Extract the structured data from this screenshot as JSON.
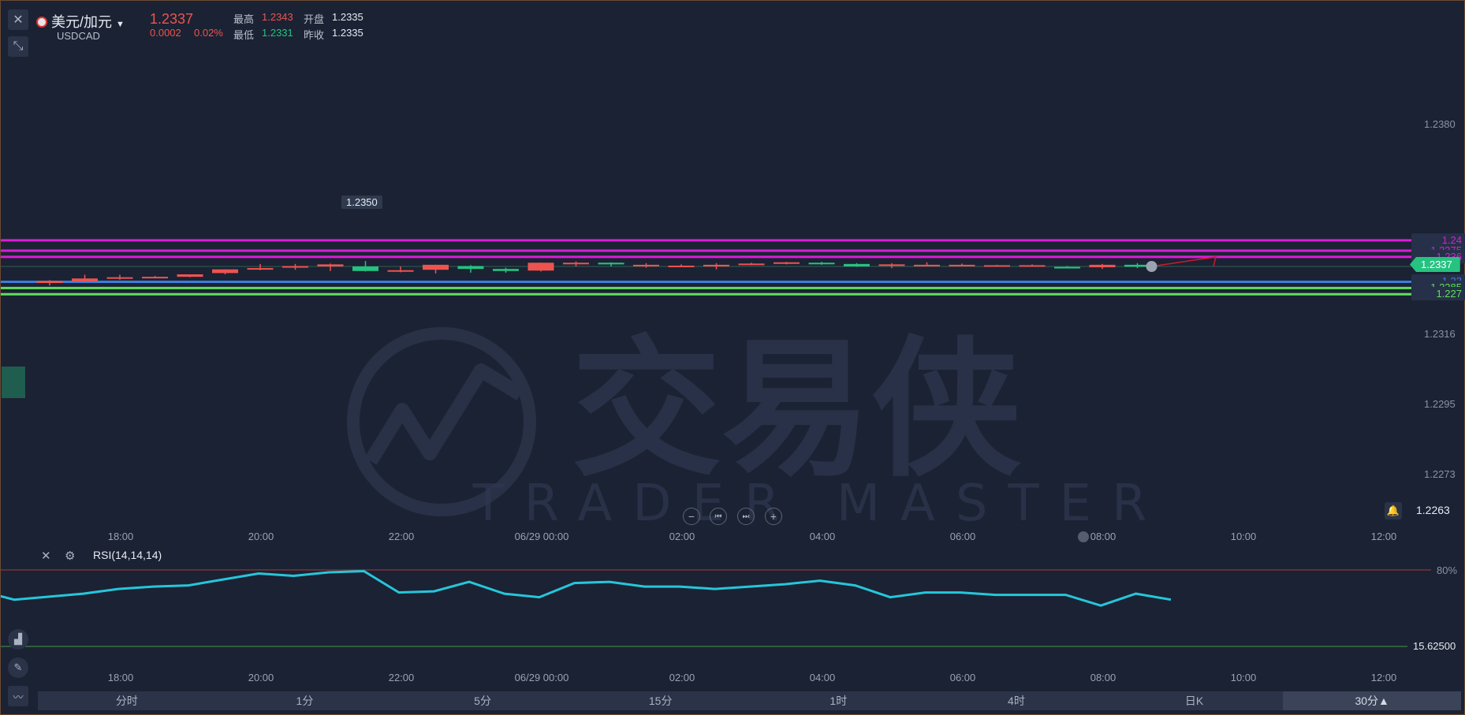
{
  "header": {
    "pair_name": "美元/加元",
    "symbol": "USDCAD",
    "last_price": "1.2337",
    "change": "0.0002",
    "change_pct": "0.02%",
    "high_label": "最高",
    "high_value": "1.2343",
    "open_label": "开盘",
    "open_value": "1.2335",
    "low_label": "最低",
    "low_value": "1.2331",
    "prev_close_label": "昨收",
    "prev_close_value": "1.2335"
  },
  "price_axis": [
    "1.2380",
    "1.2316",
    "1.2295",
    "1.2273",
    "1.2263"
  ],
  "level_lines": [
    {
      "label": "1.24",
      "price": 1.24,
      "color": "#d81ed6"
    },
    {
      "label": "1.2375",
      "price": 1.2375,
      "color": "#d81ed6"
    },
    {
      "label": "1.236",
      "price": 1.236,
      "color": "#d81ed6"
    },
    {
      "label": "1.23",
      "price": 1.23,
      "color": "#3b7ddd"
    },
    {
      "label": "1.2285",
      "price": 1.2285,
      "color": "#5ee05a"
    },
    {
      "label": "1.227",
      "price": 1.227,
      "color": "#5ee05a"
    }
  ],
  "current_price_tag": "1.2337",
  "max_annotation": "1.2350",
  "alert_price": "1.2263",
  "watermark": {
    "cn": "交易侠",
    "en": "TRADER MASTER"
  },
  "time_axis": [
    "18:00",
    "20:00",
    "22:00",
    "06/29 00:00",
    "02:00",
    "04:00",
    "06:00",
    "08:00",
    "10:00",
    "12:00"
  ],
  "rsi": {
    "label": "RSI(14,14,14)",
    "upper_level": "80%",
    "lower_value": "15.62500"
  },
  "tabs": [
    "分时",
    "1分",
    "5分",
    "15分",
    "1时",
    "4时",
    "日K",
    "30分▲"
  ],
  "colors": {
    "bull": "#ef5350",
    "bear": "#26c281",
    "rsi": "#26c6da",
    "background": "#1b2233"
  },
  "chart_data": {
    "type": "candlestick",
    "title": "",
    "candles": [
      {
        "o": 1.2297,
        "h": 1.2304,
        "l": 1.2291,
        "c": 1.2302
      },
      {
        "o": 1.2301,
        "h": 1.2317,
        "l": 1.2299,
        "c": 1.2308
      },
      {
        "o": 1.2308,
        "h": 1.2317,
        "l": 1.2305,
        "c": 1.2311
      },
      {
        "o": 1.2312,
        "h": 1.2314,
        "l": 1.231,
        "c": 1.2312
      },
      {
        "o": 1.2312,
        "h": 1.2318,
        "l": 1.2311,
        "c": 1.2318
      },
      {
        "o": 1.2321,
        "h": 1.233,
        "l": 1.2318,
        "c": 1.233
      },
      {
        "o": 1.233,
        "h": 1.2343,
        "l": 1.2328,
        "c": 1.2333
      },
      {
        "o": 1.2334,
        "h": 1.2343,
        "l": 1.2329,
        "c": 1.2338
      },
      {
        "o": 1.2337,
        "h": 1.2344,
        "l": 1.2326,
        "c": 1.2342
      },
      {
        "o": 1.2337,
        "h": 1.235,
        "l": 1.2325,
        "c": 1.2326
      },
      {
        "o": 1.2328,
        "h": 1.2337,
        "l": 1.2323,
        "c": 1.2328
      },
      {
        "o": 1.2329,
        "h": 1.2341,
        "l": 1.232,
        "c": 1.2341
      },
      {
        "o": 1.2338,
        "h": 1.234,
        "l": 1.2322,
        "c": 1.2331
      },
      {
        "o": 1.2331,
        "h": 1.2334,
        "l": 1.2322,
        "c": 1.2326
      },
      {
        "o": 1.2327,
        "h": 1.2346,
        "l": 1.2325,
        "c": 1.2346
      },
      {
        "o": 1.2345,
        "h": 1.2349,
        "l": 1.2337,
        "c": 1.2346
      },
      {
        "o": 1.2346,
        "h": 1.2347,
        "l": 1.2337,
        "c": 1.2342
      },
      {
        "o": 1.2341,
        "h": 1.2345,
        "l": 1.2334,
        "c": 1.2341
      },
      {
        "o": 1.2338,
        "h": 1.2342,
        "l": 1.2336,
        "c": 1.2339
      },
      {
        "o": 1.2337,
        "h": 1.2345,
        "l": 1.233,
        "c": 1.2341
      },
      {
        "o": 1.2342,
        "h": 1.2346,
        "l": 1.234,
        "c": 1.2344
      },
      {
        "o": 1.2346,
        "h": 1.2348,
        "l": 1.2342,
        "c": 1.2347
      },
      {
        "o": 1.2346,
        "h": 1.2348,
        "l": 1.2341,
        "c": 1.2345
      },
      {
        "o": 1.2343,
        "h": 1.2345,
        "l": 1.2336,
        "c": 1.2337
      },
      {
        "o": 1.234,
        "h": 1.2345,
        "l": 1.2333,
        "c": 1.2342
      },
      {
        "o": 1.2341,
        "h": 1.2347,
        "l": 1.2339,
        "c": 1.2341
      },
      {
        "o": 1.2341,
        "h": 1.2344,
        "l": 1.2339,
        "c": 1.2341
      },
      {
        "o": 1.234,
        "h": 1.2341,
        "l": 1.2337,
        "c": 1.234
      },
      {
        "o": 1.234,
        "h": 1.2342,
        "l": 1.2336,
        "c": 1.234
      },
      {
        "o": 1.2336,
        "h": 1.2338,
        "l": 1.2333,
        "c": 1.2334
      },
      {
        "o": 1.2335,
        "h": 1.2343,
        "l": 1.2331,
        "c": 1.2341
      },
      {
        "o": 1.2341,
        "h": 1.2345,
        "l": 1.2333,
        "c": 1.2336
      }
    ],
    "rsi_values": [
      58,
      55,
      60,
      64,
      66,
      67,
      72,
      77,
      75,
      78,
      79,
      61,
      62,
      70,
      60,
      57,
      69,
      70,
      66,
      66,
      64,
      66,
      68,
      71,
      67,
      57,
      61,
      61,
      59,
      59,
      59,
      50,
      60,
      55
    ],
    "projection_target": 1.236
  }
}
